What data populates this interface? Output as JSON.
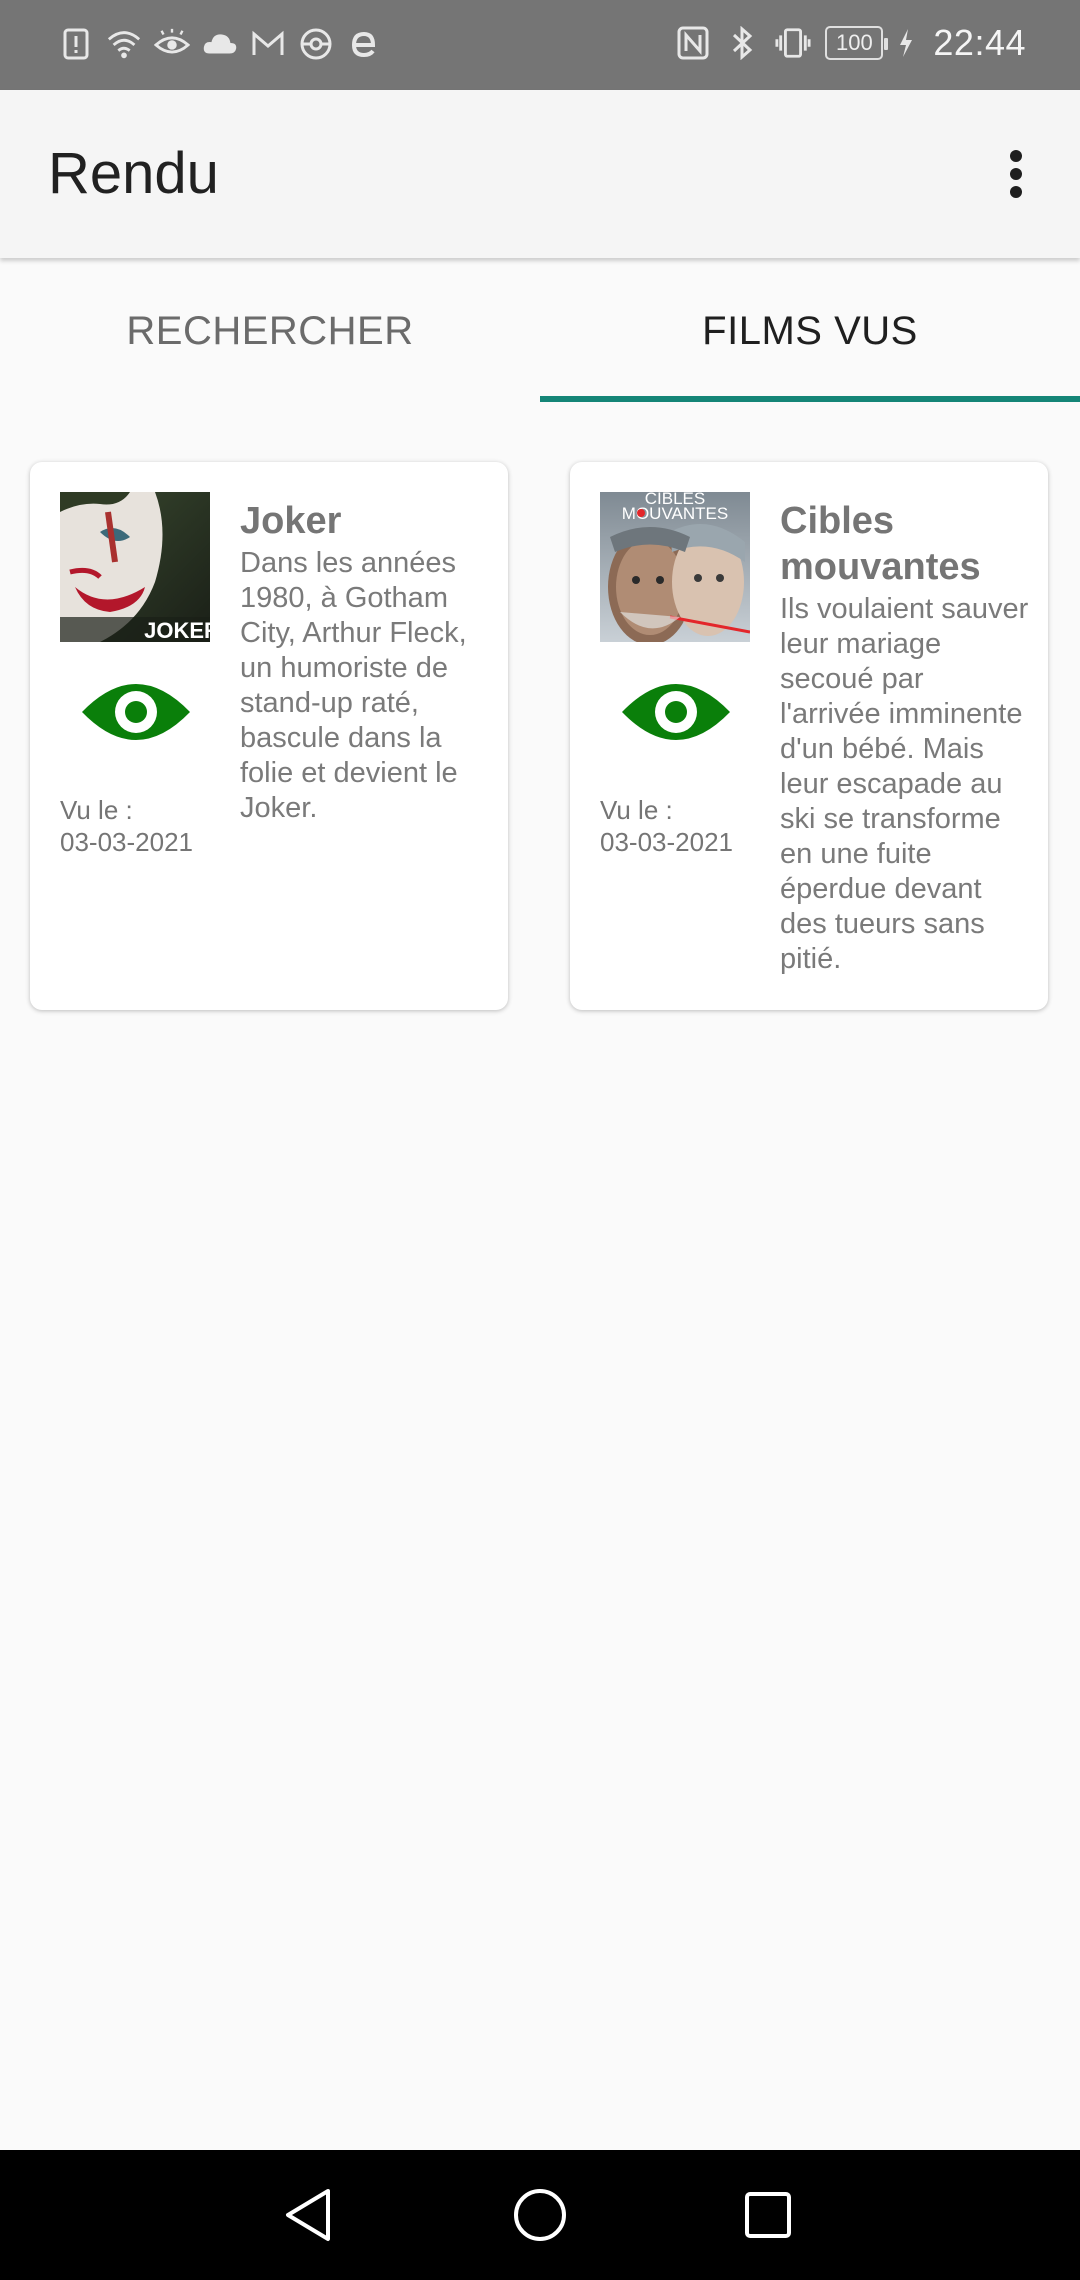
{
  "status_bar": {
    "time": "22:44",
    "battery": "100",
    "left_icons": [
      "alert-icon",
      "wifi-icon",
      "eye-icon",
      "cloud-icon",
      "gmail-icon",
      "pokeball-icon",
      "e-icon"
    ],
    "right_icons": [
      "nfc-icon",
      "bluetooth-icon",
      "vibrate-icon",
      "battery-icon",
      "charging-icon"
    ]
  },
  "app_bar": {
    "title": "Rendu",
    "overflow_icon": "more-vert-icon"
  },
  "tabs": [
    {
      "label": "RECHERCHER",
      "selected": false
    },
    {
      "label": "FILMS VUS",
      "selected": true
    }
  ],
  "accent_color": "#148577",
  "eye_color": "#0a7f0a",
  "films": [
    {
      "title": "Joker",
      "description": "Dans les années 1980, à Gotham City, Arthur Fleck, un humoriste de stand-up raté, bascule dans la folie et devient le Joker.",
      "seen_label": "Vu le :",
      "seen_date": "03-03-2021",
      "poster_text": "JOKER"
    },
    {
      "title": "Cibles mouvantes",
      "description": "Ils voulaient sauver leur mariage secoué par l'arrivée imminente d'un bébé. Mais leur escapade au ski se transforme en une fuite éperdue devant des tueurs sans pitié.",
      "seen_label": "Vu le :",
      "seen_date": "03-03-2021",
      "poster_text_top": "CIBLES",
      "poster_text_bottom": "MOUVANTES"
    }
  ],
  "nav_bar": {
    "icons": [
      "back-icon",
      "home-icon",
      "recent-apps-icon"
    ]
  }
}
